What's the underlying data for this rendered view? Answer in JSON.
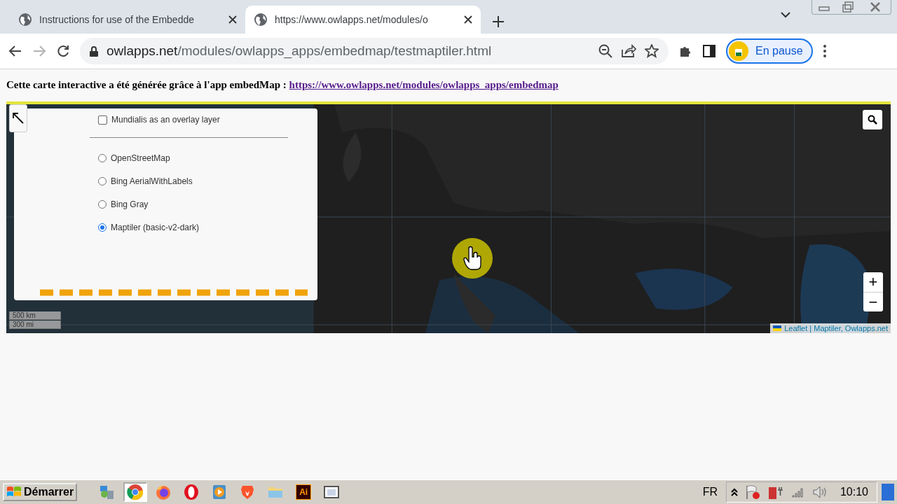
{
  "browser": {
    "tabs": [
      {
        "title": "Instructions for use of the Embedde",
        "selected": false
      },
      {
        "title": "https://www.owlapps.net/modules/o",
        "selected": true
      }
    ],
    "address": {
      "host": "owlapps.net",
      "path": "/modules/owlapps_apps/embedmap/testmaptiler.html"
    },
    "forward_disabled": true,
    "profile": {
      "label": "En pause"
    }
  },
  "page": {
    "intro": "Cette carte interactive a été générée grâce à l'app embedMap : ",
    "link": "https://www.owlapps.net/modules/owlapps_apps/embedmap"
  },
  "map": {
    "layer_panel": {
      "overlays": [
        {
          "label": "Mundialis as an overlay layer",
          "checked": false
        }
      ],
      "base_layers": [
        {
          "label": "OpenStreetMap",
          "selected": false
        },
        {
          "label": "Bing AerialWithLabels",
          "selected": false
        },
        {
          "label": "Bing Gray",
          "selected": false
        },
        {
          "label": "Maptiler (basic-v2-dark)",
          "selected": true
        }
      ]
    },
    "zoom_in": "+",
    "zoom_out": "−",
    "scale": [
      "500 km",
      "300 mi"
    ],
    "attribution": "Leaflet | Maptiler, Owlapps.net"
  },
  "taskbar": {
    "start": "Démarrer",
    "apps": [
      {
        "kind": "network",
        "selected": false
      },
      {
        "kind": "chrome",
        "selected": true
      },
      {
        "kind": "firefox",
        "selected": false
      },
      {
        "kind": "opera",
        "selected": false
      },
      {
        "kind": "media",
        "selected": false
      },
      {
        "kind": "brave",
        "selected": false
      },
      {
        "kind": "explorer",
        "selected": false
      },
      {
        "kind": "illustrator",
        "selected": false,
        "label": "Ai"
      },
      {
        "kind": "window",
        "selected": false
      }
    ],
    "language": "FR",
    "clock": "10:10"
  }
}
